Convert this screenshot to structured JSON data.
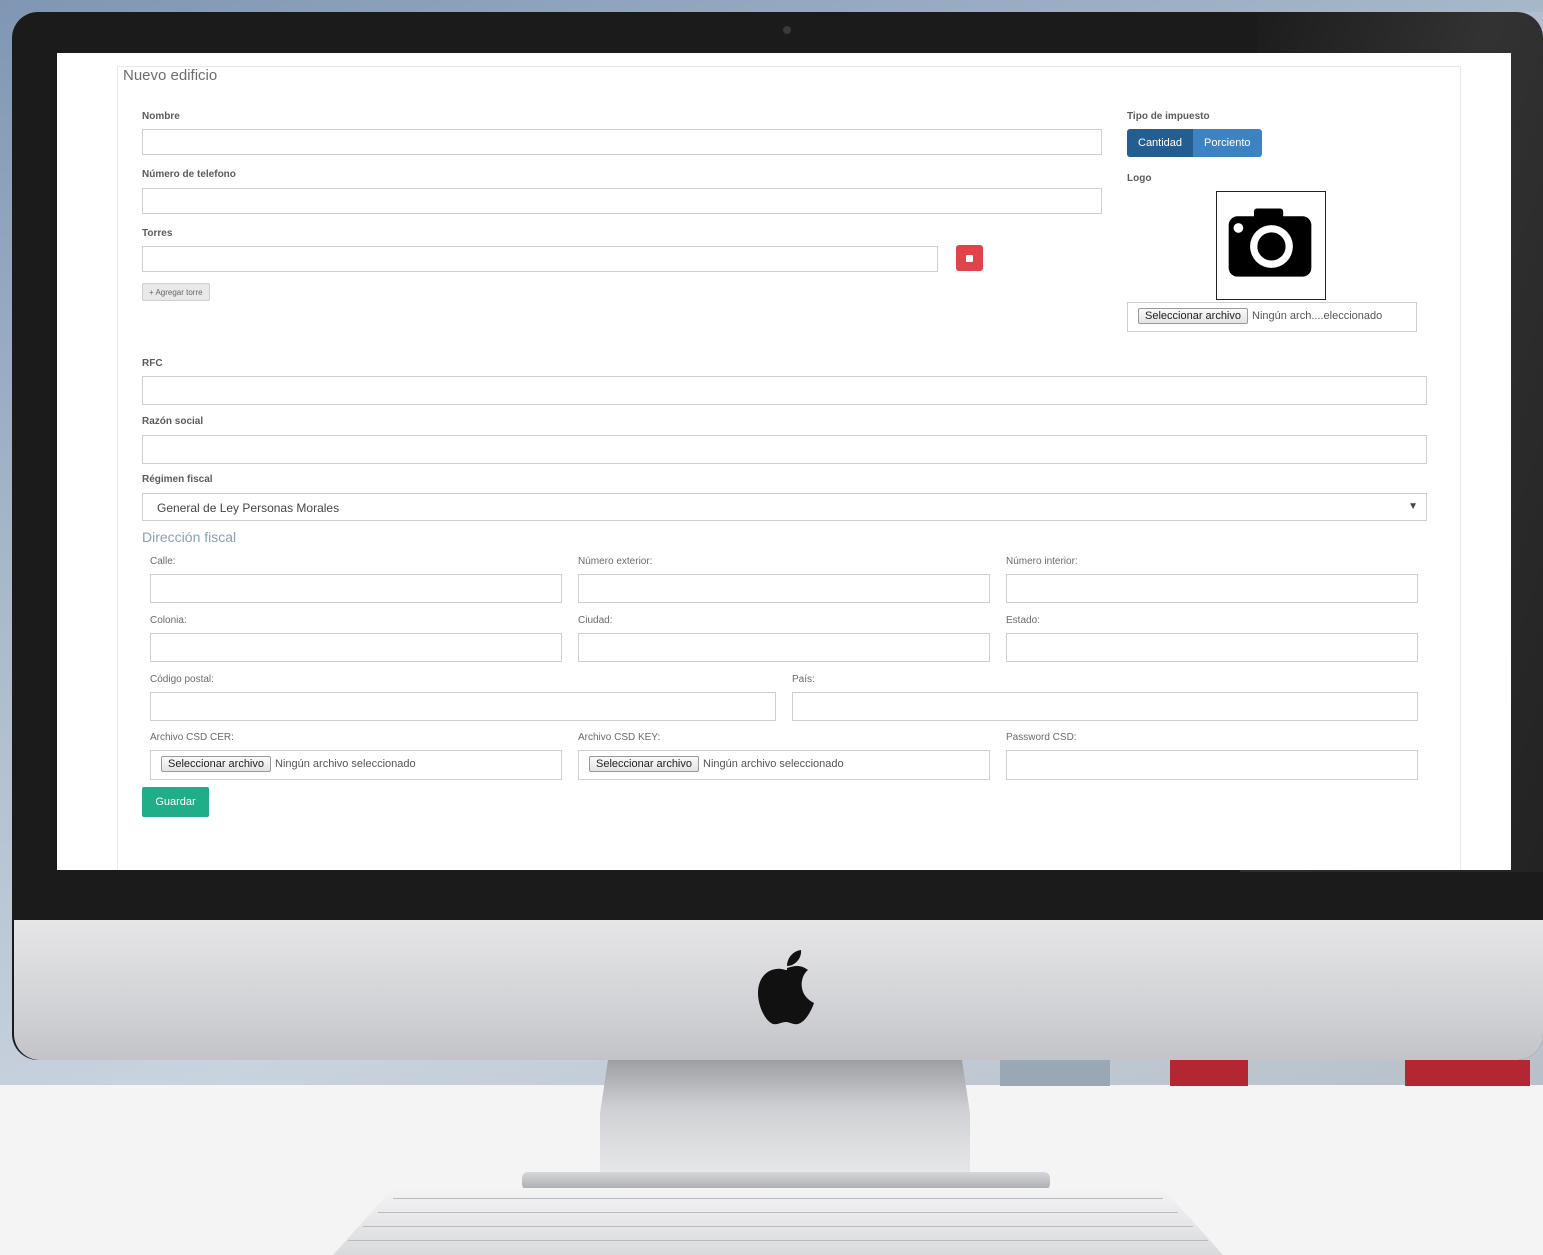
{
  "form": {
    "title": "Nuevo edificio",
    "nombre_label": "Nombre",
    "telefono_label": "Número de telefono",
    "torres_label": "Torres",
    "agregar_torre_label": "+ Agregar torre",
    "tipo_impuesto_label": "Tipo de impuesto",
    "tipo_impuesto_options": [
      "Cantidad",
      "Porciento"
    ],
    "tipo_impuesto_selected": "Cantidad",
    "logo_label": "Logo",
    "logo_file_button": "Seleccionar archivo",
    "logo_file_status": "Ningún arch....eleccionado",
    "rfc_label": "RFC",
    "razon_social_label": "Razón social",
    "regimen_label": "Régimen fiscal",
    "regimen_value": "General de Ley Personas Morales",
    "direccion_title": "Dirección fiscal",
    "calle_label": "Calle:",
    "num_ext_label": "Número exterior:",
    "num_int_label": "Número interior:",
    "colonia_label": "Colonia:",
    "ciudad_label": "Ciudad:",
    "estado_label": "Estado:",
    "cp_label": "Código postal:",
    "pais_label": "País:",
    "csd_cer_label": "Archivo CSD CER:",
    "csd_key_label": "Archivo CSD KEY:",
    "password_csd_label": "Password CSD:",
    "file_button": "Seleccionar archivo",
    "file_status": "Ningún archivo seleccionado",
    "guardar_label": "Guardar"
  },
  "icons": {
    "camera": "camera-icon",
    "delete": "trash-icon",
    "apple": "apple-logo-icon"
  },
  "colors": {
    "primary_toggle": "#3d83c2",
    "primary_toggle_active": "#245e91",
    "danger": "#e2434b",
    "success": "#1fae87",
    "section_title": "#8aa0b5"
  }
}
